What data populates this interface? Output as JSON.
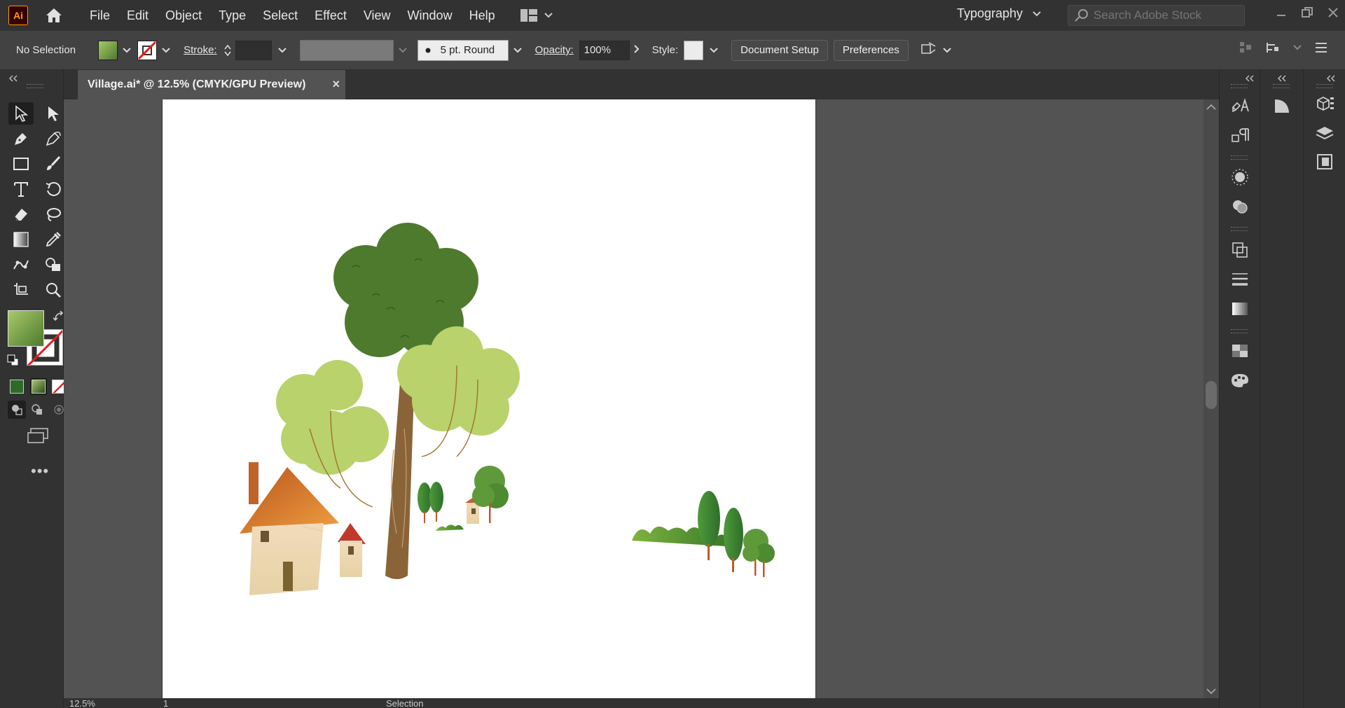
{
  "app": {
    "logo": "Ai"
  },
  "menu": [
    "File",
    "Edit",
    "Object",
    "Type",
    "Select",
    "Effect",
    "View",
    "Window",
    "Help"
  ],
  "workspace": {
    "name": "Typography"
  },
  "search": {
    "placeholder": "Search Adobe Stock"
  },
  "control": {
    "selection": "No Selection",
    "stroke_label": "Stroke:",
    "brush": "5 pt. Round",
    "opacity_label": "Opacity:",
    "opacity_value": "100%",
    "style_label": "Style:",
    "document_setup": "Document Setup",
    "preferences": "Preferences"
  },
  "document": {
    "tab_title": "Village.ai* @ 12.5% (CMYK/GPU Preview)"
  },
  "status": {
    "zoom": "12.5%",
    "artboard": "1",
    "tool": "Selection"
  },
  "colors": {
    "fill_start": "#a8c96a",
    "fill_end": "#4d7a2e",
    "stroke": "none"
  }
}
